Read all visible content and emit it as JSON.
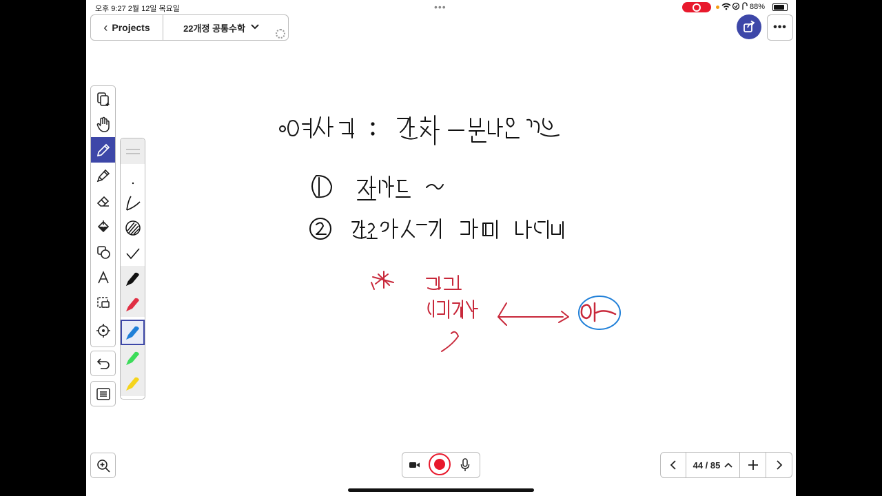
{
  "status_bar": {
    "time": "오후 9:27",
    "date": "2월 12일 목요일",
    "battery": "88%"
  },
  "header": {
    "back_label": "Projects",
    "document_title": "22개정 공통수학"
  },
  "pager": {
    "page_count": "44 / 85"
  },
  "icons": {
    "toolbar": [
      "copy-page-icon",
      "hand-icon",
      "pen-icon",
      "highlighter-icon",
      "eraser-icon",
      "fill-icon",
      "shape-icon",
      "text-icon",
      "lasso-icon",
      "laser-pointer-icon"
    ],
    "palette": [
      "thickness-line",
      "dot-stroke",
      "line-stroke",
      "pattern-stroke",
      "check-stroke",
      "black-pen",
      "red-pen",
      "blue-pen",
      "green-pen",
      "yellow-pen"
    ]
  },
  "colors": {
    "accent": "#3d47a8",
    "record": "#e8192c",
    "ink_black": "#111111",
    "ink_red": "#c8283a",
    "ink_blue": "#1f7fd8"
  }
}
